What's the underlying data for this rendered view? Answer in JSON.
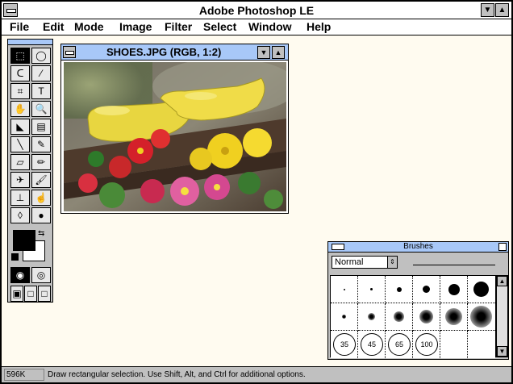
{
  "app": {
    "title": "Adobe Photoshop LE",
    "minimize_glyph": "▼",
    "maximize_glyph": "▲"
  },
  "menu": [
    {
      "label": "File"
    },
    {
      "label": "Edit"
    },
    {
      "label": "Mode"
    },
    {
      "label": "Image"
    },
    {
      "label": "Filter"
    },
    {
      "label": "Select"
    },
    {
      "label": "Window"
    },
    {
      "label": "Help"
    }
  ],
  "toolbox": {
    "tools": [
      {
        "name": "marquee-rect-icon",
        "glyph": "⬚"
      },
      {
        "name": "marquee-ellipse-icon",
        "glyph": "◯"
      },
      {
        "name": "lasso-icon",
        "glyph": "ᑕ"
      },
      {
        "name": "magic-wand-icon",
        "glyph": "⁄"
      },
      {
        "name": "crop-icon",
        "glyph": "⌗"
      },
      {
        "name": "type-icon",
        "glyph": "T"
      },
      {
        "name": "hand-icon",
        "glyph": "✋"
      },
      {
        "name": "zoom-icon",
        "glyph": "🔍"
      },
      {
        "name": "paint-bucket-icon",
        "glyph": "◣"
      },
      {
        "name": "gradient-icon",
        "glyph": "▤"
      },
      {
        "name": "line-icon",
        "glyph": "╲"
      },
      {
        "name": "eyedropper-icon",
        "glyph": "✎"
      },
      {
        "name": "eraser-icon",
        "glyph": "▱"
      },
      {
        "name": "pencil-icon",
        "glyph": "✏"
      },
      {
        "name": "airbrush-icon",
        "glyph": "✈"
      },
      {
        "name": "paintbrush-icon",
        "glyph": "🖌"
      },
      {
        "name": "rubber-stamp-icon",
        "glyph": "⊥"
      },
      {
        "name": "smudge-icon",
        "glyph": "☝"
      },
      {
        "name": "blur-icon",
        "glyph": "◊"
      },
      {
        "name": "burn-icon",
        "glyph": "●"
      }
    ]
  },
  "document": {
    "title": "SHOES.JPG  (RGB, 1:2)",
    "down_glyph": "▼",
    "up_glyph": "▲"
  },
  "brushes": {
    "title": "Brushes",
    "mode": "Normal",
    "arrow_glyph": "⇕",
    "sizes": [
      "35",
      "45",
      "65",
      "100"
    ],
    "scroll_up": "▲",
    "scroll_down": "▼"
  },
  "status": {
    "size": "596K",
    "message": "Draw rectangular selection. Use Shift, Alt, and Ctrl for additional options."
  },
  "colors": {
    "title_bar_active": "#a8c8f8",
    "chrome": "#c0c0c0",
    "workspace": "#fffbf0"
  }
}
